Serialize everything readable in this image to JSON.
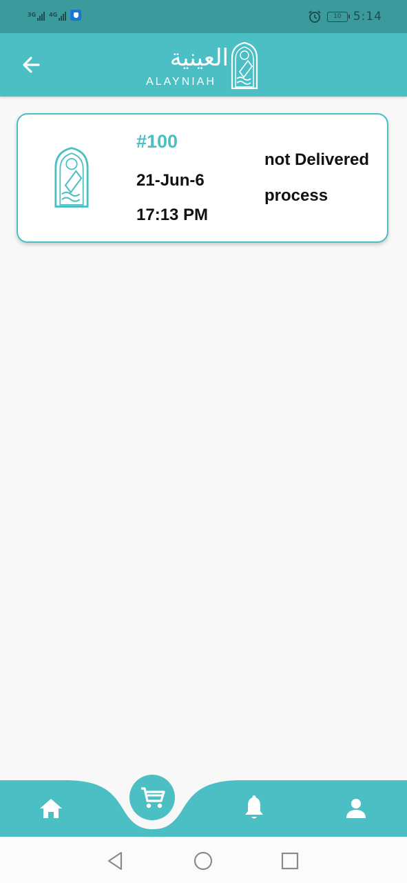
{
  "status_bar": {
    "network_1": "3G",
    "network_2": "4G",
    "battery": "10",
    "time": "5:14"
  },
  "header": {
    "back_icon": "arrow-left-icon",
    "logo_arabic": "العينية",
    "logo_latin": "ALAYNIAH"
  },
  "order": {
    "number": "#100",
    "date": "21-Jun-6",
    "time": "17:13 PM",
    "status": "not Delivered",
    "state": "process"
  },
  "bottom_nav": {
    "items": [
      {
        "icon": "home-icon"
      },
      {
        "icon": "cart-icon",
        "active": true
      },
      {
        "icon": "bell-icon"
      },
      {
        "icon": "person-icon"
      }
    ]
  },
  "colors": {
    "primary": "#4bbfc4",
    "status_bar": "#3b9a9c",
    "text": "#111111"
  }
}
